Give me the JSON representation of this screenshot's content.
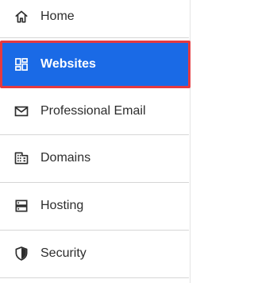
{
  "sidebar": {
    "items": [
      {
        "label": "Home",
        "icon": "home-icon"
      },
      {
        "label": "Websites",
        "icon": "dashboard-icon",
        "active": true
      },
      {
        "label": "Professional Email",
        "icon": "mail-icon"
      },
      {
        "label": "Domains",
        "icon": "building-icon"
      },
      {
        "label": "Hosting",
        "icon": "server-icon"
      },
      {
        "label": "Security",
        "icon": "shield-icon"
      }
    ]
  },
  "colors": {
    "active_bg": "#1a6ae6",
    "active_border": "#e53a40",
    "text": "#2d2d2d"
  }
}
